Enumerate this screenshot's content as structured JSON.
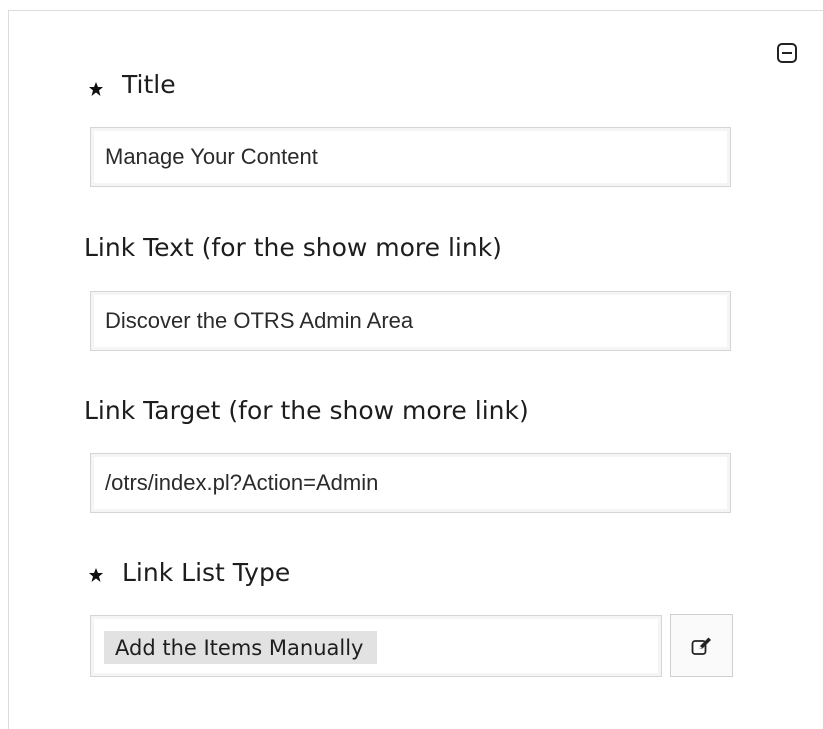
{
  "widget": {
    "collapse_icon": "minus-square-icon",
    "fields": {
      "title": {
        "label": "Title",
        "required": true,
        "value": "Manage Your Content"
      },
      "link_text": {
        "label": "Link Text (for the show more link)",
        "required": false,
        "value": "Discover the OTRS Admin Area"
      },
      "link_target": {
        "label": "Link Target (for the show more link)",
        "required": false,
        "value": "/otrs/index.pl?Action=Admin"
      },
      "link_list_type": {
        "label": "Link List Type",
        "required": true,
        "selected": "Add the Items Manually",
        "edit_icon": "edit-icon"
      }
    }
  }
}
